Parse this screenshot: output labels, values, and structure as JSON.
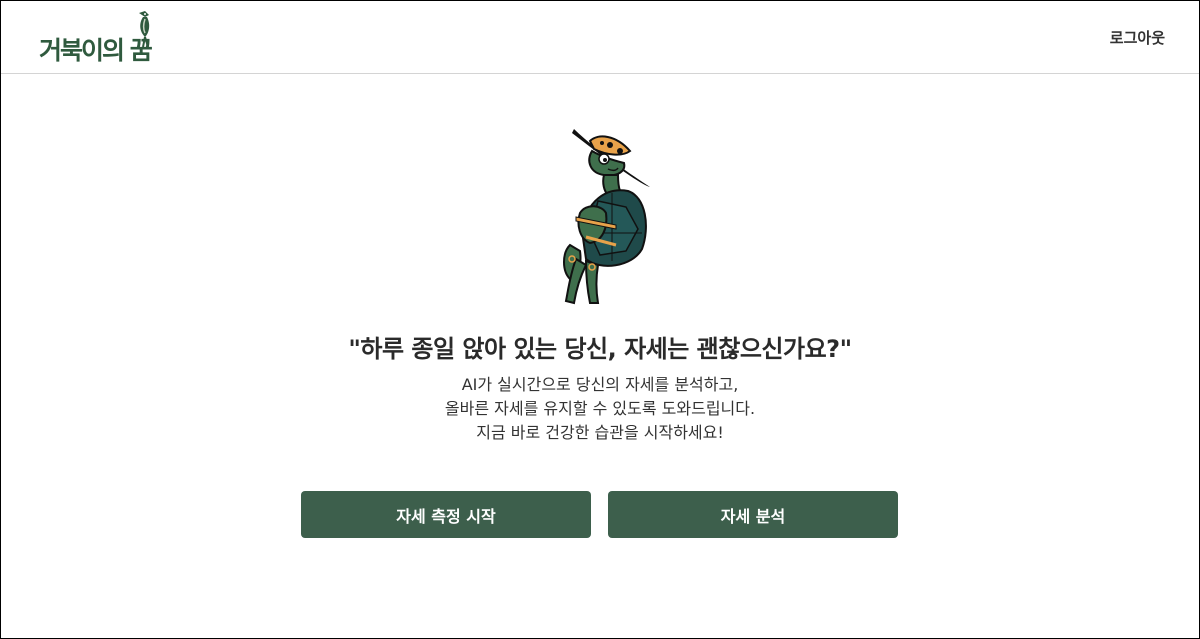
{
  "header": {
    "logo_text": "거북이의 꿈",
    "logout_label": "로그아웃"
  },
  "main": {
    "headline": "\"하루 종일 앉아 있는 당신, 자세는 괜찮으신가요?\"",
    "description_lines": [
      "AI가 실시간으로 당신의 자세를 분석하고,",
      "올바른 자세를 유지할 수 있도록 도와드립니다.",
      "지금 바로 건강한 습관을 시작하세요!"
    ],
    "buttons": {
      "start_label": "자세 측정 시작",
      "analysis_label": "자세 분석"
    }
  },
  "colors": {
    "brand_green": "#2f5a3e",
    "button_bg": "#3d5f4c",
    "accent_orange": "#e8a24a"
  },
  "icons": {
    "logo_bird": "bird-icon",
    "illustration": "turtle-illustration"
  }
}
